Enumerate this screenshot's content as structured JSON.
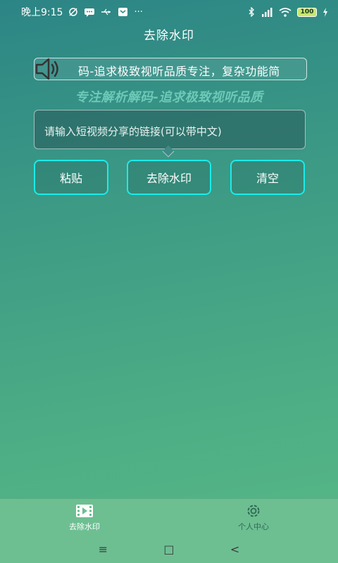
{
  "status_bar": {
    "time": "晚上9:15",
    "battery": "100"
  },
  "header": {
    "title": "去除水印"
  },
  "marquee": {
    "text": "码-追求极致视听品质专注，复杂功能简"
  },
  "slogan": "专注解析解码-追求极致视听品质",
  "link_input": {
    "placeholder": "请输入短视频分享的链接(可以带中文)",
    "value": ""
  },
  "buttons": {
    "paste": "粘贴",
    "remove_watermark": "去除水印",
    "clear": "清空"
  },
  "tabs": [
    {
      "label": "去除水印",
      "icon": "video-icon",
      "active": true
    },
    {
      "label": "个人中心",
      "icon": "gear-icon",
      "active": false
    }
  ],
  "nav": {
    "menu": "≡",
    "home": "□",
    "back": "<"
  },
  "colors": {
    "accent_border": "#19ecea",
    "slogan": "#6dc9b7",
    "tab_bar": "#6dbf92"
  }
}
